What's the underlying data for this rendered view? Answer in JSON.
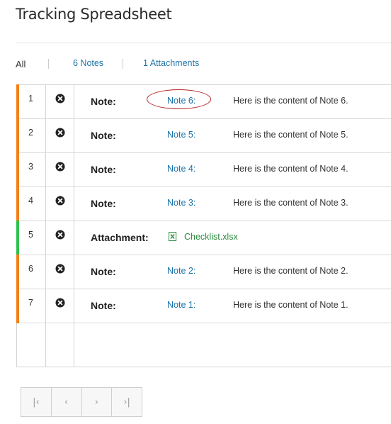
{
  "header": {
    "title": "Tracking Spreadsheet"
  },
  "filters": {
    "all": "All",
    "notes": "6 Notes",
    "attachments": "1 Attachments"
  },
  "colors": {
    "note": "#f57f17",
    "attachment": "#2ec24b",
    "link": "#1e73a8",
    "annotation": "#b51d1d"
  },
  "rows": [
    {
      "num": "1",
      "type": "Note:",
      "link": "Note 6:",
      "content": "Here is the content of Note 6.",
      "kind": "note"
    },
    {
      "num": "2",
      "type": "Note:",
      "link": "Note 5:",
      "content": "Here is the content of Note 5.",
      "kind": "note"
    },
    {
      "num": "3",
      "type": "Note:",
      "link": "Note 4:",
      "content": "Here is the content of Note 4.",
      "kind": "note"
    },
    {
      "num": "4",
      "type": "Note:",
      "link": "Note 3:",
      "content": "Here is the content of Note 3.",
      "kind": "note"
    },
    {
      "num": "5",
      "type": "Attachment:",
      "link": "Checklist.xlsx",
      "content": "",
      "kind": "attachment",
      "icon": "excel-file-icon"
    },
    {
      "num": "6",
      "type": "Note:",
      "link": "Note 2:",
      "content": "Here is the content of Note 2.",
      "kind": "note"
    },
    {
      "num": "7",
      "type": "Note:",
      "link": "Note 1:",
      "content": "Here is the content of Note 1.",
      "kind": "note"
    }
  ],
  "pager": {
    "first": "|‹",
    "prev": "‹",
    "next": "›",
    "last": "›|"
  }
}
